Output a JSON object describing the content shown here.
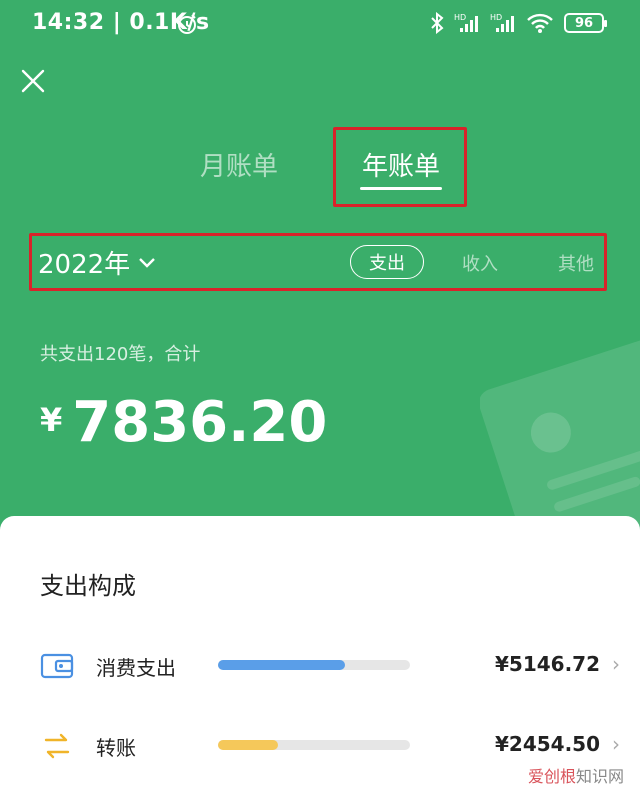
{
  "status": {
    "time": "14:32 | 0.1K/s",
    "battery": "96"
  },
  "tabs": {
    "month": "月账单",
    "year": "年账单"
  },
  "filters": {
    "year": "2022年",
    "expense": "支出",
    "income": "收入",
    "other": "其他"
  },
  "summary": {
    "text": "共支出120笔，合计",
    "currency": "¥",
    "amount": "7836.20"
  },
  "breakdown": {
    "title": "支出构成",
    "items": [
      {
        "label": "消费支出",
        "value": "¥5146.72",
        "share": 0.66,
        "color": "#5a9ee8",
        "icon": "wallet-icon"
      },
      {
        "label": "转账",
        "value": "¥2454.50",
        "share": 0.31,
        "color": "#f5c85a",
        "icon": "transfer-icon"
      }
    ]
  },
  "watermark": {
    "brand": "爱创根",
    "site": "知识网"
  }
}
